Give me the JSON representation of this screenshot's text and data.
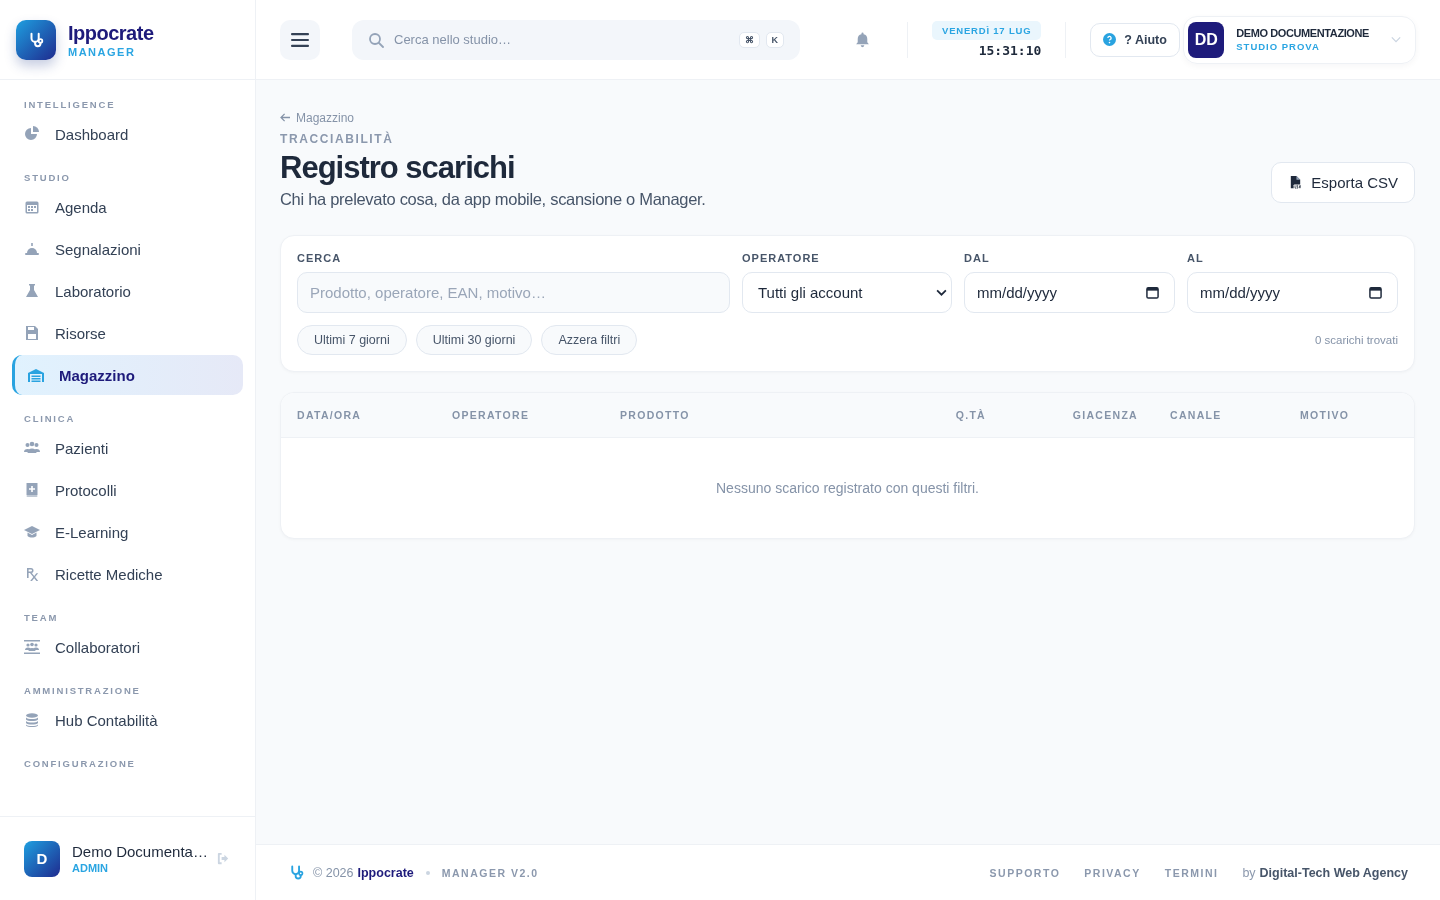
{
  "brand": {
    "name": "Ippocrate",
    "subtitle": "MANAGER"
  },
  "sidebar": {
    "sections": [
      {
        "label": "INTELLIGENCE",
        "items": [
          {
            "label": "Dashboard",
            "selected": false
          }
        ]
      },
      {
        "label": "STUDIO",
        "items": [
          {
            "label": "Agenda",
            "selected": false
          },
          {
            "label": "Segnalazioni",
            "selected": false
          },
          {
            "label": "Laboratorio",
            "selected": false
          },
          {
            "label": "Risorse",
            "selected": false
          },
          {
            "label": "Magazzino",
            "selected": true
          }
        ]
      },
      {
        "label": "CLINICA",
        "items": [
          {
            "label": "Pazienti",
            "selected": false
          },
          {
            "label": "Protocolli",
            "selected": false
          },
          {
            "label": "E-Learning",
            "selected": false
          },
          {
            "label": "Ricette Mediche",
            "selected": false
          }
        ]
      },
      {
        "label": "TEAM",
        "items": [
          {
            "label": "Collaboratori",
            "selected": false
          }
        ]
      },
      {
        "label": "AMMINISTRAZIONE",
        "items": [
          {
            "label": "Hub Contabilità",
            "selected": false
          }
        ]
      },
      {
        "label": "CONFIGURAZIONE"
      }
    ]
  },
  "user": {
    "initial": "D",
    "name": "Demo Documenta…",
    "role": "ADMIN"
  },
  "topbar": {
    "search": {
      "placeholder": "Cerca nello studio…",
      "keys": [
        "⌘",
        "K"
      ]
    },
    "date": "VENERDÌ 17 LUG",
    "time": "15:31:10",
    "help": "? Aiuto",
    "account": {
      "initials": "DD",
      "name": "DEMO DOCUMENTAZIONE",
      "studio": "STUDIO PROVA"
    }
  },
  "page": {
    "breadcrumb": "Magazzino",
    "eyebrow": "TRACCIABILITÀ",
    "title": "Registro scarichi",
    "subtitle": "Chi ha prelevato cosa, da app mobile, scansione o Manager.",
    "export_button": "Esporta CSV"
  },
  "filters": {
    "fields": [
      {
        "kind": "text",
        "label": "CERCA",
        "placeholder": "Prodotto, operatore, EAN, motivo…"
      },
      {
        "kind": "select",
        "label": "OPERATORE",
        "value": "Tutti gli account"
      },
      {
        "kind": "date",
        "label": "DAL",
        "placeholder": "mm/dd/yyyy"
      },
      {
        "kind": "date",
        "label": "AL",
        "placeholder": "mm/dd/yyyy"
      }
    ],
    "chips": [
      "Ultimi 7 giorni",
      "Ultimi 30 giorni",
      "Azzera filtri"
    ],
    "count": "0 scarichi trovati"
  },
  "table": {
    "columns": [
      "DATA/ORA",
      "OPERATORE",
      "PRODOTTO",
      "Q.TÀ",
      "GIACENZA",
      "CANALE",
      "MOTIVO"
    ],
    "empty_message": "Nessuno scarico registrato con questi filtri."
  },
  "footer": {
    "copyright": "© 2026",
    "brand": "Ippocrate",
    "version": "MANAGER V2.0",
    "links": [
      "SUPPORTO",
      "PRIVACY",
      "TERMINI"
    ],
    "credit_prefix": "by",
    "credit": "Digital-Tech Web Agency"
  }
}
